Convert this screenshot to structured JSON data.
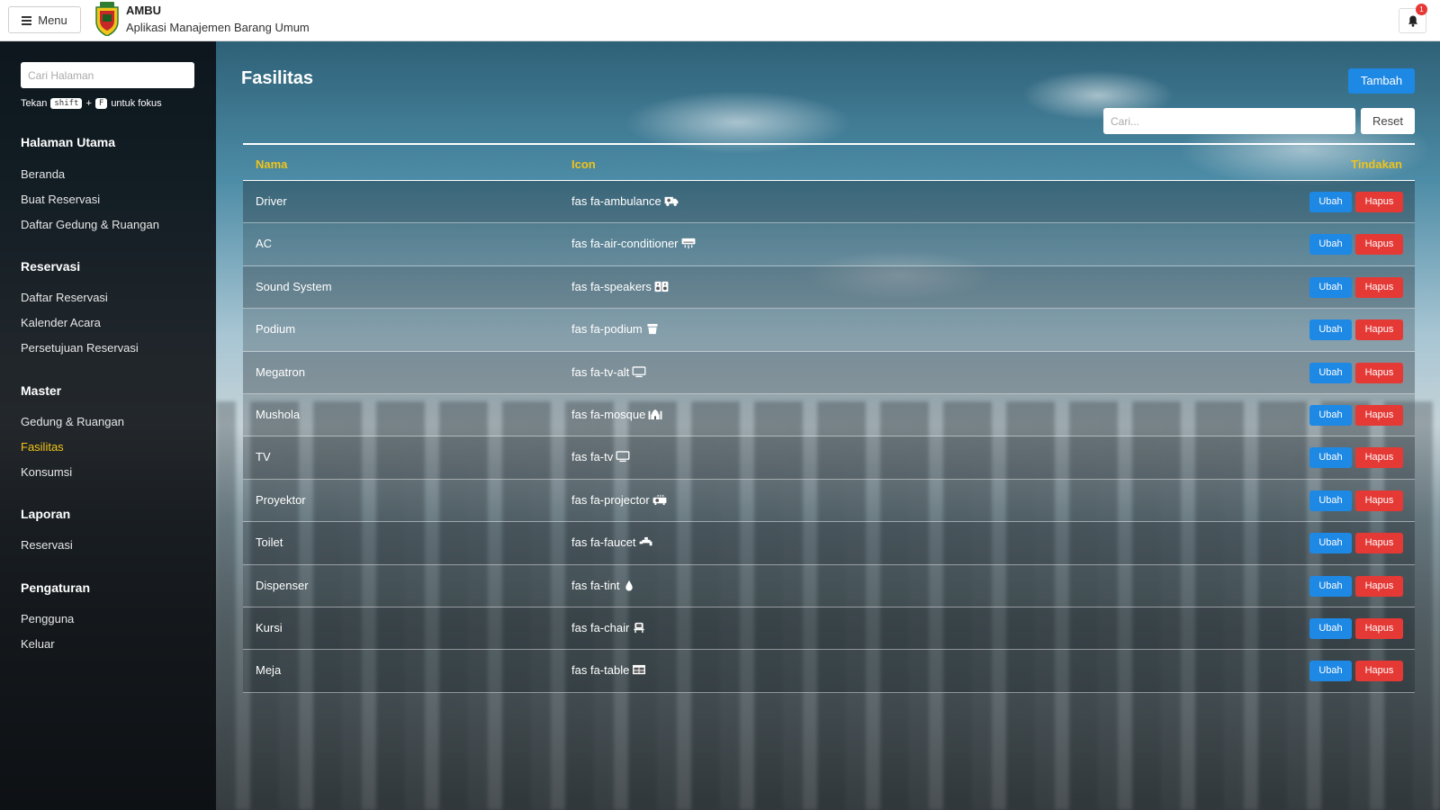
{
  "header": {
    "menu_label": "Menu",
    "app_name": "AMBU",
    "app_subtitle": "Aplikasi Manajemen Barang Umum",
    "notification_count": "1"
  },
  "sidebar": {
    "search_placeholder": "Cari Halaman",
    "hint": {
      "prefix": "Tekan",
      "key1": "shift",
      "plus": "+",
      "key2": "F",
      "suffix": "untuk fokus"
    },
    "sections": [
      {
        "title": "Halaman Utama",
        "items": [
          "Beranda",
          "Buat Reservasi",
          "Daftar Gedung & Ruangan"
        ]
      },
      {
        "title": "Reservasi",
        "items": [
          "Daftar Reservasi",
          "Kalender Acara",
          "Persetujuan Reservasi"
        ]
      },
      {
        "title": "Master",
        "items": [
          "Gedung & Ruangan",
          "Fasilitas",
          "Konsumsi"
        ]
      },
      {
        "title": "Laporan",
        "items": [
          "Reservasi"
        ]
      },
      {
        "title": "Pengaturan",
        "items": [
          "Pengguna",
          "Keluar"
        ]
      }
    ],
    "active_item": "Fasilitas"
  },
  "main": {
    "title": "Fasilitas",
    "add_button": "Tambah",
    "search_placeholder": "Cari...",
    "reset_button": "Reset",
    "columns": {
      "name": "Nama",
      "icon": "Icon",
      "actions": "Tindakan"
    },
    "edit_label": "Ubah",
    "delete_label": "Hapus",
    "rows": [
      {
        "name": "Driver",
        "icon": "fas fa-ambulance",
        "glyph": "ambulance-icon"
      },
      {
        "name": "AC",
        "icon": "fas fa-air-conditioner",
        "glyph": "air-conditioner-icon"
      },
      {
        "name": "Sound System",
        "icon": "fas fa-speakers",
        "glyph": "speakers-icon"
      },
      {
        "name": "Podium",
        "icon": "fas fa-podium",
        "glyph": "podium-icon"
      },
      {
        "name": "Megatron",
        "icon": "fas fa-tv-alt",
        "glyph": "tv-alt-icon"
      },
      {
        "name": "Mushola",
        "icon": "fas fa-mosque",
        "glyph": "mosque-icon"
      },
      {
        "name": "TV",
        "icon": "fas fa-tv",
        "glyph": "tv-icon"
      },
      {
        "name": "Proyektor",
        "icon": "fas fa-projector",
        "glyph": "projector-icon"
      },
      {
        "name": "Toilet",
        "icon": "fas fa-faucet",
        "glyph": "faucet-icon"
      },
      {
        "name": "Dispenser",
        "icon": "fas fa-tint",
        "glyph": "tint-icon"
      },
      {
        "name": "Kursi",
        "icon": "fas fa-chair",
        "glyph": "chair-icon"
      },
      {
        "name": "Meja",
        "icon": "fas fa-table",
        "glyph": "table-icon"
      }
    ]
  },
  "colors": {
    "primary": "#1e88e5",
    "danger": "#e53935",
    "accent": "#f0c419"
  }
}
